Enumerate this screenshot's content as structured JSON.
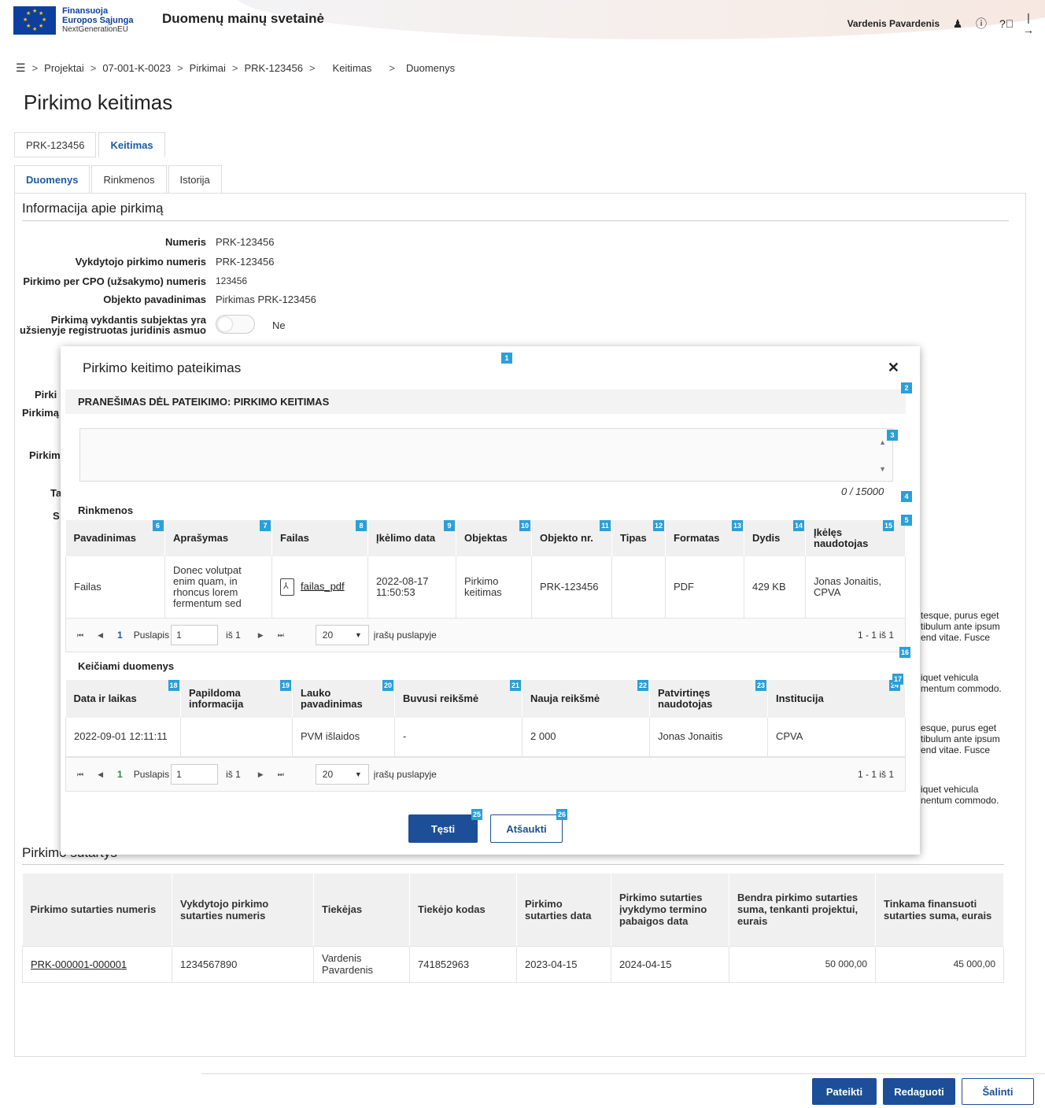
{
  "header": {
    "logo_line1": "Finansuoja",
    "logo_line2": "Europos Sąjunga",
    "logo_line3": "NextGenerationEU",
    "site_title": "Duomenų mainų svetainė",
    "user_name": "Vardenis Pavardenis",
    "icons": [
      "user-icon",
      "info-icon",
      "help-icon",
      "logout-icon"
    ]
  },
  "breadcrumb": [
    "Projektai",
    "07-001-K-0023",
    "Pirkimai",
    "PRK-123456",
    "Keitimas",
    "Duomenys"
  ],
  "page_title": "Pirkimo keitimas",
  "top_tabs": [
    "PRK-123456",
    "Keitimas"
  ],
  "sub_tabs": [
    "Duomenys",
    "Rinkmenos",
    "Istorija"
  ],
  "info": {
    "section_title": "Informacija apie pirkimą",
    "rows": [
      {
        "label": "Numeris",
        "value": "PRK-123456"
      },
      {
        "label": "Vykdytojo pirkimo numeris",
        "value": "PRK-123456"
      },
      {
        "label": "Pirkimo per CPO (užsakymo) numeris",
        "value": "123456"
      },
      {
        "label": "Objekto pavadinimas",
        "value": "Pirkimas PRK-123456"
      },
      {
        "label": "Pirkimą vykdantis subjektas yra užsienyje registruotas juridinis asmuo",
        "value": "Ne"
      }
    ],
    "partial_labels": [
      "Pirki",
      "Pirkimą",
      "Pirkim",
      "Ta",
      "S"
    ],
    "partial_texts": [
      "tesque, purus eget\ntibulum ante ipsum\nend vitae. Fusce",
      "iquet vehicula\nmentum commodo.",
      "esque, purus eget\ntibulum ante ipsum\nend vitae. Fusce",
      "iquet vehicula\nnentum commodo."
    ]
  },
  "contracts": {
    "title": "Pirkimo sutartys",
    "headers": [
      "Pirkimo sutarties numeris",
      "Vykdytojo pirkimo sutarties numeris",
      "Tiekėjas",
      "Tiekėjo kodas",
      "Pirkimo sutarties data",
      "Pirkimo sutarties įvykdymo termino pabaigos data",
      "Bendra pirkimo sutarties suma, tenkanti projektui, eurais",
      "Tinkama finansuoti sutarties suma, eurais"
    ],
    "rows": [
      [
        "PRK-000001-000001",
        "1234567890",
        "Vardenis Pavardenis",
        "741852963",
        "2023-04-15",
        "2024-04-15",
        "50 000,00",
        "45 000,00"
      ]
    ]
  },
  "footer": {
    "submit": "Pateikti",
    "edit": "Redaguoti",
    "delete": "Šalinti"
  },
  "modal": {
    "title": "Pirkimo keitimo pateikimas",
    "notice": "PRANEŠIMAS DĖL PATEIKIMO: PIRKIMO KEITIMAS",
    "textarea_value": "",
    "counter": "0 / 15000",
    "files_title": "Rinkmenos",
    "files_headers": [
      "Pavadinimas",
      "Aprašymas",
      "Failas",
      "Įkėlimo data",
      "Objektas",
      "Objekto nr.",
      "Tipas",
      "Formatas",
      "Dydis",
      "Įkėlęs naudotojas"
    ],
    "files_rows": [
      [
        "Failas",
        "Donec volutpat enim quam, in rhoncus lorem fermentum sed",
        "failas_pdf",
        "2022-08-17 11:50:53",
        "Pirkimo keitimas",
        "PRK-123456",
        "",
        "PDF",
        "429 KB",
        "Jonas Jonaitis, CPVA"
      ]
    ],
    "changes_title": "Keičiami duomenys",
    "changes_headers": [
      "Data ir laikas",
      "Papildoma informacija",
      "Lauko pavadinimas",
      "Buvusi reikšmė",
      "Nauja reikšmė",
      "Patvirtinęs naudotojas",
      "Institucija"
    ],
    "changes_rows": [
      [
        "2022-09-01 12:11:11",
        "",
        "PVM išlaidos",
        "-",
        "2 000",
        "Jonas Jonaitis",
        "CPVA"
      ]
    ],
    "pager": {
      "page_label": "Puslapis",
      "page_value": "1",
      "of_label": "iš 1",
      "current": "1",
      "per_page_value": "20",
      "per_page_label": "įrašų puslapyje",
      "summary": "1 - 1 iš 1"
    },
    "continue": "Tęsti",
    "cancel": "Atšaukti",
    "badges": [
      "1",
      "2",
      "3",
      "4",
      "5",
      "6",
      "7",
      "8",
      "9",
      "10",
      "11",
      "12",
      "13",
      "14",
      "15",
      "16",
      "17",
      "18",
      "19",
      "20",
      "21",
      "22",
      "23",
      "24",
      "25",
      "26"
    ]
  }
}
